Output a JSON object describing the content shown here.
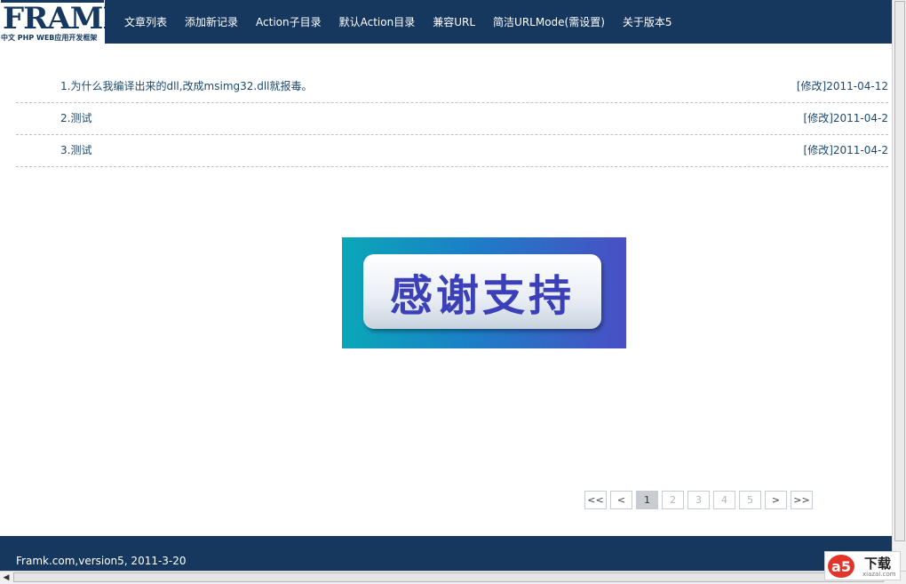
{
  "header": {
    "logo_text": "FRAMK",
    "logo_subtitle": "中文 PHP WEB应用开发框架",
    "nav": [
      {
        "label": "文章列表"
      },
      {
        "label": "添加新记录"
      },
      {
        "label": "Action子目录"
      },
      {
        "label": "默认Action目录"
      },
      {
        "label": "兼容URL"
      },
      {
        "label": "简洁URLMode(需设置)"
      },
      {
        "label": "关于版本5"
      }
    ]
  },
  "articles": [
    {
      "title": "1.为什么我编译出来的dll,改成msimg32.dll就报毒。",
      "edit_label": "[修改]",
      "date": "2011-04-12"
    },
    {
      "title": "2.测试",
      "edit_label": "[修改]",
      "date": "2011-04-2"
    },
    {
      "title": "3.测试",
      "edit_label": "[修改]",
      "date": "2011-04-2"
    }
  ],
  "banner": {
    "text": "感谢支持"
  },
  "pagination": {
    "first": "<<",
    "prev": "<",
    "pages": [
      "1",
      "2",
      "3",
      "4",
      "5"
    ],
    "current": "1",
    "next": ">",
    "last": ">>"
  },
  "footer": {
    "text": "Framk.com,version5, 2011-3-20"
  },
  "watermark": {
    "logo": "a5",
    "text": "下载",
    "url": "xiazai.com"
  },
  "colors": {
    "header_bg": "#16385e",
    "link": "#1c4a72",
    "banner_text": "#3b40b8"
  }
}
